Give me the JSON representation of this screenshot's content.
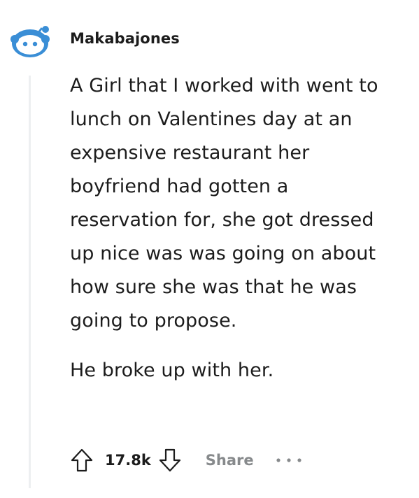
{
  "comment": {
    "username": "Makabajones",
    "body": [
      "A Girl that I worked with went to lunch on Valentines day at an expensive restaurant her boyfriend had gotten a reservation for, she got dressed up nice was was going on about how sure she was that he was going to propose.",
      "He broke up with her."
    ],
    "score": "17.8k",
    "share_label": "Share"
  },
  "icons": {
    "avatar": "snoo-avatar-icon",
    "upvote": "upvote-arrow-icon",
    "downvote": "downvote-arrow-icon",
    "more": "more-options-icon"
  },
  "colors": {
    "text": "#1c1c1c",
    "muted": "#878a8c",
    "avatar_blue": "#3a8ed6",
    "thread_line": "#edeff1"
  }
}
